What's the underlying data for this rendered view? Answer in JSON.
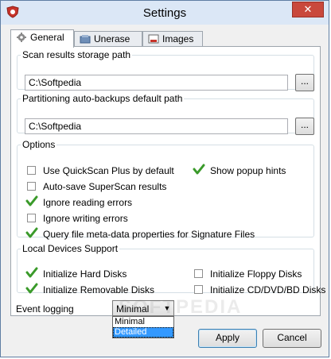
{
  "window": {
    "title": "Settings",
    "close_label": "✕"
  },
  "tabs": [
    {
      "label": "General",
      "icon": "gear-icon"
    },
    {
      "label": "Unerase",
      "icon": "unerase-icon"
    },
    {
      "label": "Images",
      "icon": "images-icon"
    }
  ],
  "scan_path": {
    "legend": "Scan results storage path",
    "value": "C:\\Softpedia",
    "browse_label": "..."
  },
  "backup_path": {
    "legend": "Partitioning auto-backups default path",
    "value": "C:\\Softpedia",
    "browse_label": "..."
  },
  "options": {
    "legend": "Options",
    "items": [
      {
        "label": "Use QuickScan Plus by default",
        "checked": false
      },
      {
        "label": "Auto-save SuperScan results",
        "checked": false
      },
      {
        "label": "Ignore reading errors",
        "checked": true
      },
      {
        "label": "Ignore writing errors",
        "checked": false
      },
      {
        "label": "Query file meta-data properties for Signature Files",
        "checked": true
      },
      {
        "label": "Show popup hints",
        "checked": true
      }
    ]
  },
  "devices": {
    "legend": "Local Devices Support",
    "items": [
      {
        "label": "Initialize Hard Disks",
        "checked": true
      },
      {
        "label": "Initialize Removable Disks",
        "checked": true
      },
      {
        "label": "Initialize Floppy Disks",
        "checked": false
      },
      {
        "label": "Initialize CD/DVD/BD Disks",
        "checked": false
      }
    ]
  },
  "event_logging": {
    "label": "Event logging",
    "selected": "Minimal",
    "options": [
      "Minimal",
      "Detailed"
    ],
    "highlighted": "Detailed"
  },
  "watermark": "SOFTPEDIA",
  "buttons": {
    "apply": "Apply",
    "cancel": "Cancel"
  },
  "colors": {
    "check_green": "#3a9a2a",
    "selection_blue": "#3399ff",
    "close_red": "#c9483c"
  }
}
